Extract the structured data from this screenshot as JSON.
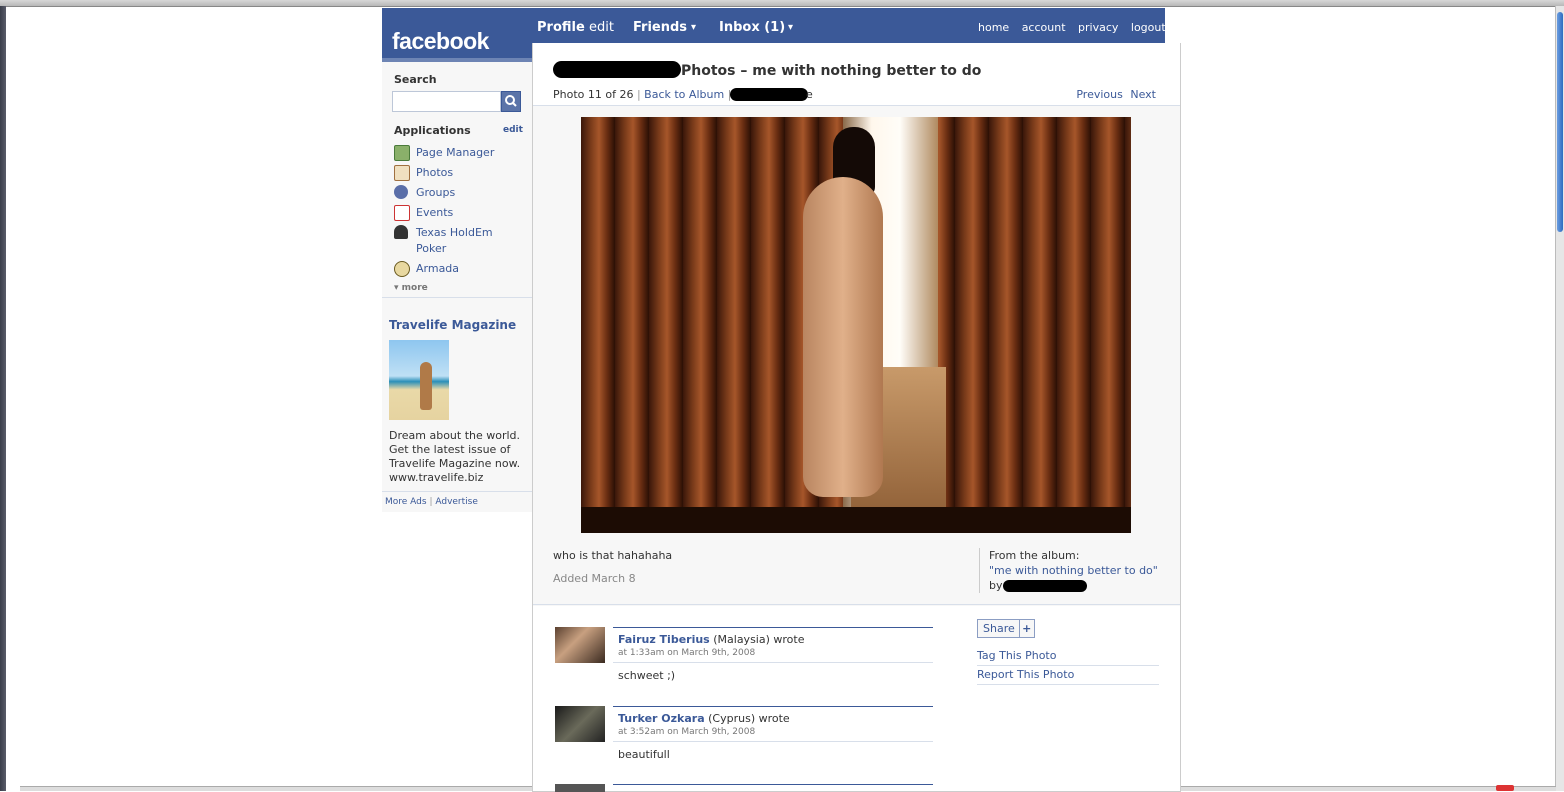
{
  "header": {
    "logo": "facebook",
    "nav_profile": "Profile",
    "nav_edit": "edit",
    "nav_friends": "Friends",
    "nav_inbox": "Inbox (1)",
    "dropdown_glyph": "▾",
    "right_links": [
      "home",
      "account",
      "privacy",
      "logout"
    ]
  },
  "sidebar": {
    "search_label": "Search",
    "search_placeholder": "",
    "applications_label": "Applications",
    "applications_edit": "edit",
    "apps": [
      {
        "label": "Page Manager",
        "icon": "page-manager-icon"
      },
      {
        "label": "Photos",
        "icon": "photos-icon"
      },
      {
        "label": "Groups",
        "icon": "groups-icon"
      },
      {
        "label": "Events",
        "icon": "events-icon"
      },
      {
        "label": "Texas HoldEm Poker",
        "icon": "poker-icon"
      },
      {
        "label": "Armada",
        "icon": "armada-icon"
      }
    ],
    "more": "▾ more"
  },
  "ad": {
    "title": "Travelife Magazine",
    "text": "Dream about the world. Get the latest issue of Travelife Magazine now. www.travelife.biz",
    "more_ads": "More Ads",
    "advertise": "Advertise"
  },
  "photo_page": {
    "title_suffix": "Photos – me with nothing better to do",
    "counter": "Photo 11 of 26",
    "back_to_album": "Back to Album",
    "name_tail": "e",
    "previous": "Previous",
    "next": "Next",
    "caption": "who is that hahahaha",
    "added": "Added March 8",
    "from_album_label": "From the album:",
    "album_name": "\"me with nothing better to do\"",
    "by_label": "by"
  },
  "comments": [
    {
      "name": "Fairuz Tiberius",
      "location": "(Malaysia) wrote",
      "time": "at 1:33am on March 9th, 2008",
      "text": "schweet ;)"
    },
    {
      "name": "Turker Ozkara",
      "location": "(Cyprus) wrote",
      "time": "at 3:52am on March 9th, 2008",
      "text": "beautifull"
    }
  ],
  "actions": {
    "share": "Share",
    "share_plus": "+",
    "tag": "Tag This Photo",
    "report": "Report This Photo"
  },
  "colors": {
    "brand": "#3b5998",
    "link": "#3b5998"
  }
}
